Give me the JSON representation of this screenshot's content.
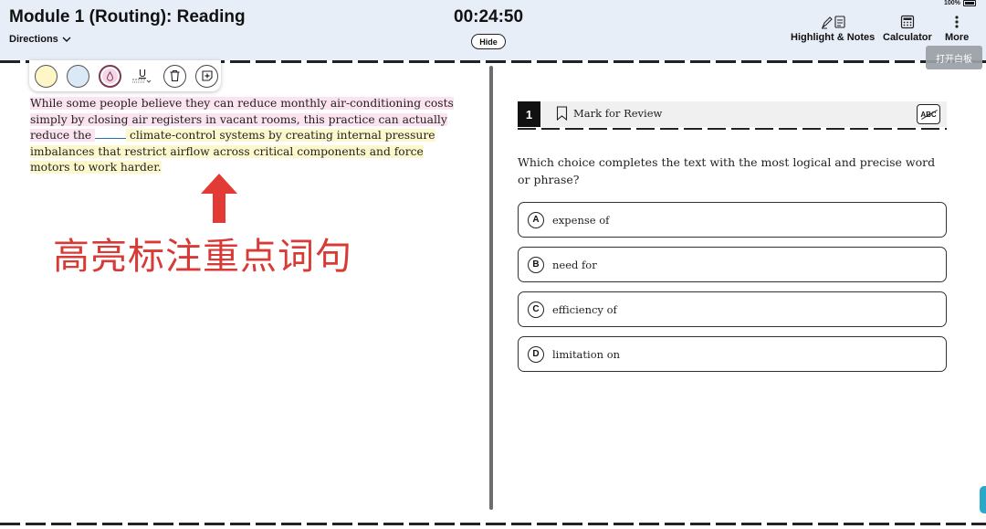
{
  "header": {
    "module_title": "Module 1 (Routing): Reading",
    "directions_label": "Directions",
    "timer": "00:24:50",
    "hide_label": "Hide",
    "tools": {
      "highlight_label": "Highlight & Notes",
      "calculator_label": "Calculator",
      "more_label": "More"
    },
    "battery": "100%"
  },
  "whiteboard_button": "打开白板",
  "annotation_toolbar": {
    "underline_glyph": "U"
  },
  "passage": {
    "part1": "While some people believe they can reduce monthly air-conditioning costs simply by closing air registers in vacant rooms, this practice can actually reduce the ",
    "part2": " climate-control systems by creating internal pressure imbalances that restrict airflow across critical components and force motors to work harder."
  },
  "annotation_text": "高亮标注重点词句",
  "question": {
    "number": "1",
    "mark_for_review": "Mark for Review",
    "abc_label": "ABC",
    "prompt": "Which choice completes the text with the most logical and precise word or phrase?",
    "choices": [
      {
        "letter": "A",
        "text": "expense of"
      },
      {
        "letter": "B",
        "text": "need for"
      },
      {
        "letter": "C",
        "text": "efficiency of"
      },
      {
        "letter": "D",
        "text": "limitation on"
      }
    ]
  },
  "colors": {
    "header_bg": "#e8eef8",
    "highlight_pink": "#fbe3ef",
    "highlight_yellow": "#fdf8cc",
    "annotation_red": "#d93a35"
  }
}
